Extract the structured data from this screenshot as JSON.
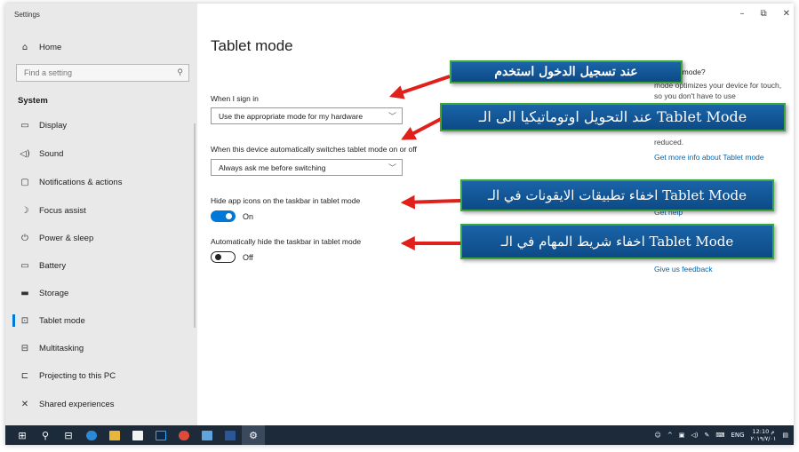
{
  "window": {
    "title": "Settings",
    "minimize": "–",
    "restore": "⧉",
    "close": "✕"
  },
  "sidebar": {
    "home": {
      "icon": "home-icon",
      "label": "Home"
    },
    "search": {
      "placeholder": "Find a setting"
    },
    "section_heading": "System",
    "items": [
      {
        "icon": "display-icon",
        "label": "Display"
      },
      {
        "icon": "sound-icon",
        "label": "Sound"
      },
      {
        "icon": "notifications-icon",
        "label": "Notifications & actions"
      },
      {
        "icon": "focus-assist-icon",
        "label": "Focus assist"
      },
      {
        "icon": "power-icon",
        "label": "Power & sleep"
      },
      {
        "icon": "battery-icon",
        "label": "Battery"
      },
      {
        "icon": "storage-icon",
        "label": "Storage"
      },
      {
        "icon": "tablet-icon",
        "label": "Tablet mode",
        "selected": true
      },
      {
        "icon": "multitasking-icon",
        "label": "Multitasking"
      },
      {
        "icon": "projecting-icon",
        "label": "Projecting to this PC"
      },
      {
        "icon": "shared-icon",
        "label": "Shared experiences"
      }
    ]
  },
  "main": {
    "title": "Tablet mode",
    "sign_in": {
      "label": "When I sign in",
      "value": "Use the appropriate mode for my hardware"
    },
    "auto_switch": {
      "label": "When this device automatically switches tablet mode on or off",
      "value": "Always ask me before switching"
    },
    "hide_icons": {
      "label": "Hide app icons on the taskbar in tablet mode",
      "state": "On",
      "on": true
    },
    "hide_taskbar": {
      "label": "Automatically hide the taskbar in tablet mode",
      "state": "Off",
      "on": false
    }
  },
  "info_panel": {
    "title": "is tablet mode?",
    "body": "mode optimizes your device for touch, so you don't have to use",
    "reduced": "reduced.",
    "link": "Get more info about Tablet mode",
    "help": "Get help",
    "feedback": "Give us feedback"
  },
  "callouts": [
    {
      "text": "عند تسجيل الدخول استخدم"
    },
    {
      "text": "عند التحويل اوتوماتيكيا الى الـ Tablet Mode"
    },
    {
      "text": "اخفاء تطبيقات الايقونات في الـ Tablet Mode"
    },
    {
      "text": "اخفاء شريط المهام في الـ Tablet Mode"
    }
  ],
  "taskbar": {
    "tray_lang": "ENG",
    "time": "12:10 م",
    "date": "٢٠١٩/٧/٠١"
  },
  "colors": {
    "accent": "#0078d7",
    "callout_bg": "#1a64a8",
    "callout_border": "#3fa63f",
    "arrow": "#e0201b",
    "taskbar": "#1c2a3a"
  }
}
